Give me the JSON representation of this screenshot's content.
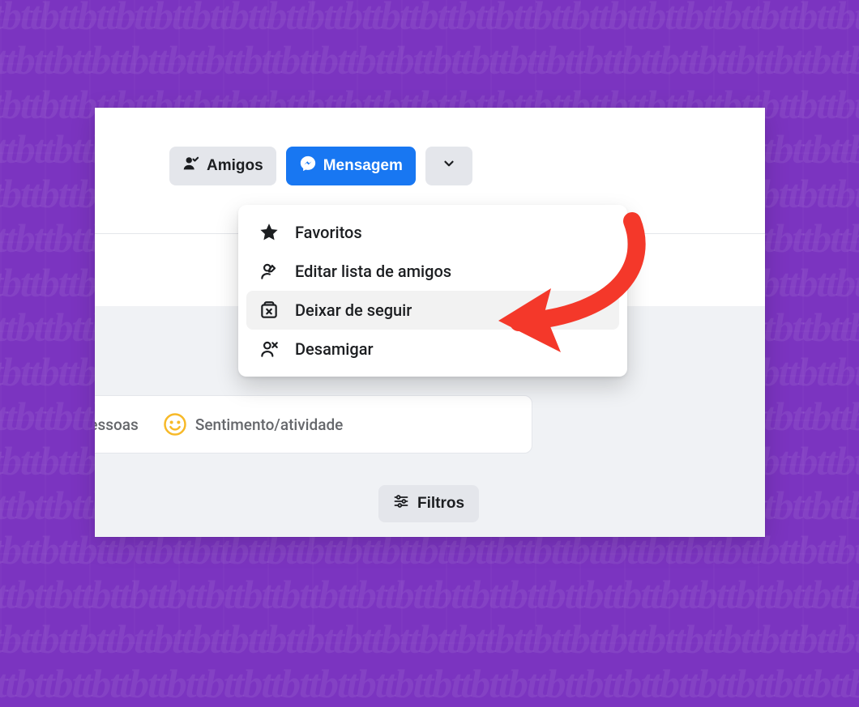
{
  "colors": {
    "background_purple": "#7b34c0",
    "primary_blue": "#1877f2",
    "secondary_gray": "#e4e6eb",
    "text_dark": "#1c1e21",
    "text_muted": "#65676b",
    "annotation_red": "#f4382a"
  },
  "toolbar": {
    "friends_label": "Amigos",
    "message_label": "Mensagem"
  },
  "dropdown": {
    "items": [
      {
        "label": "Favoritos",
        "icon": "star-icon"
      },
      {
        "label": "Editar lista de amigos",
        "icon": "edit-friends-icon"
      },
      {
        "label": "Deixar de seguir",
        "icon": "unfollow-icon",
        "hovered": true
      },
      {
        "label": "Desamigar",
        "icon": "unfriend-icon"
      }
    ]
  },
  "composer": {
    "tag_people_partial": "car pessoas",
    "feeling_activity": "Sentimento/atividade"
  },
  "filters": {
    "label": "Filtros"
  }
}
